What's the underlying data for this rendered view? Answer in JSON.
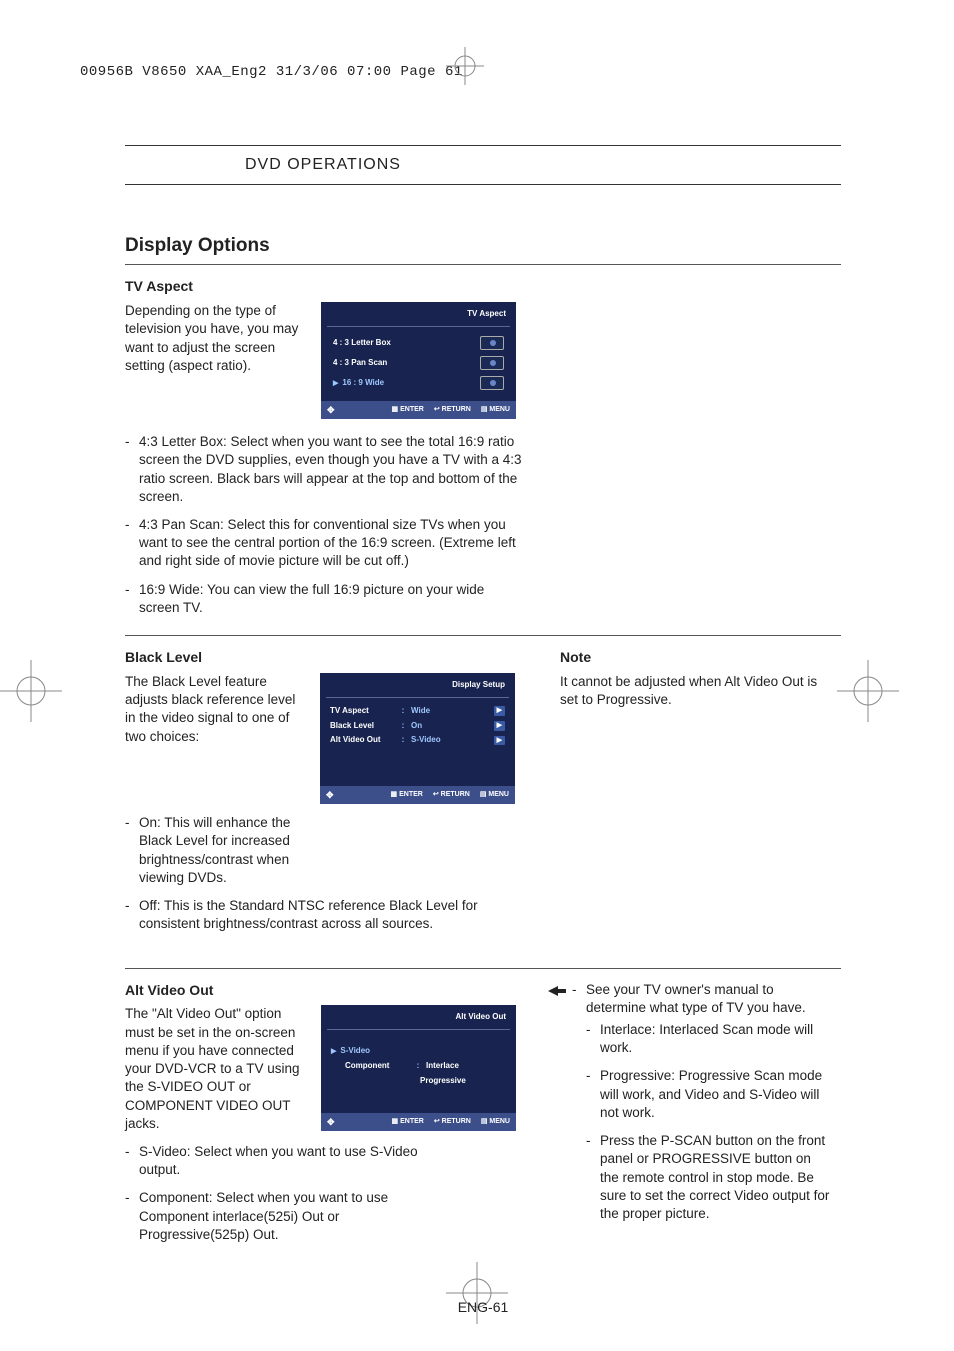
{
  "doc_header": "00956B V8650 XAA_Eng2  31/3/06  07:00  Page 61",
  "section_title": "DVD OPERATIONS",
  "main_heading": "Display Options",
  "tv_aspect": {
    "heading": "TV Aspect",
    "intro": "Depending on the type of television you have, you may want to adjust the screen setting (aspect ratio).",
    "items": [
      "4:3 Letter Box: Select when you want to see the total 16:9 ratio screen the DVD supplies, even though you have a TV with a 4:3 ratio screen. Black bars will appear at the top and bottom of the screen.",
      "4:3 Pan Scan: Select this for conventional size TVs when you want to see the central portion of the 16:9 screen. (Extreme left and right side of movie picture will be cut off.)",
      "16:9 Wide: You can view the full 16:9 picture on your wide screen TV."
    ],
    "osd": {
      "title": "TV Aspect",
      "options": [
        "4 : 3  Letter Box",
        "4 : 3  Pan Scan",
        "16 : 9  Wide"
      ],
      "buttons": [
        "ENTER",
        "RETURN",
        "MENU"
      ]
    }
  },
  "black_level": {
    "heading": "Black Level",
    "intro": "The Black Level feature adjusts black reference level in the video signal to one of two choices:",
    "items": [
      "On: This will enhance the Black Level for increased brightness/contrast when viewing DVDs.",
      "Off: This is the Standard NTSC reference Black Level for consistent brightness/contrast across all sources."
    ],
    "osd": {
      "title": "Display Setup",
      "rows": [
        {
          "label": "TV Aspect",
          "value": "Wide"
        },
        {
          "label": "Black Level",
          "value": "On"
        },
        {
          "label": "Alt Video Out",
          "value": "S-Video"
        }
      ],
      "buttons": [
        "ENTER",
        "RETURN",
        "MENU"
      ]
    },
    "note_heading": "Note",
    "note_text": "It cannot be adjusted when Alt Video Out is set to Progressive."
  },
  "alt_video": {
    "heading": "Alt  Video Out",
    "intro": "The \"Alt  Video Out\" option must be set in the on-screen menu if you have connected your DVD-VCR to a TV using the S-VIDEO OUT or COMPONENT VIDEO OUT jacks.",
    "items": [
      "S-Video: Select when you want to use S-Video output.",
      "Component: Select when you want to use Component interlace(525i) Out or Progressive(525p) Out."
    ],
    "osd": {
      "title": "Alt Video Out",
      "rows": [
        {
          "label": "S-Video",
          "value": ""
        },
        {
          "label": "Component",
          "value": "Interlace"
        }
      ],
      "extra": "Progressive",
      "buttons": [
        "ENTER",
        "RETURN",
        "MENU"
      ]
    },
    "right": {
      "lead": "See your TV owner's manual to determine what type of TV you have.",
      "items": [
        "Interlace: Interlaced Scan mode will work.",
        "Progressive: Progressive Scan mode will work, and Video and S-Video will not work.",
        "Press the P-SCAN button on the front panel or PROGRESSIVE button on the remote control in stop mode. Be sure to set the correct Video output for the proper picture."
      ]
    }
  },
  "page_number": "ENG-61"
}
